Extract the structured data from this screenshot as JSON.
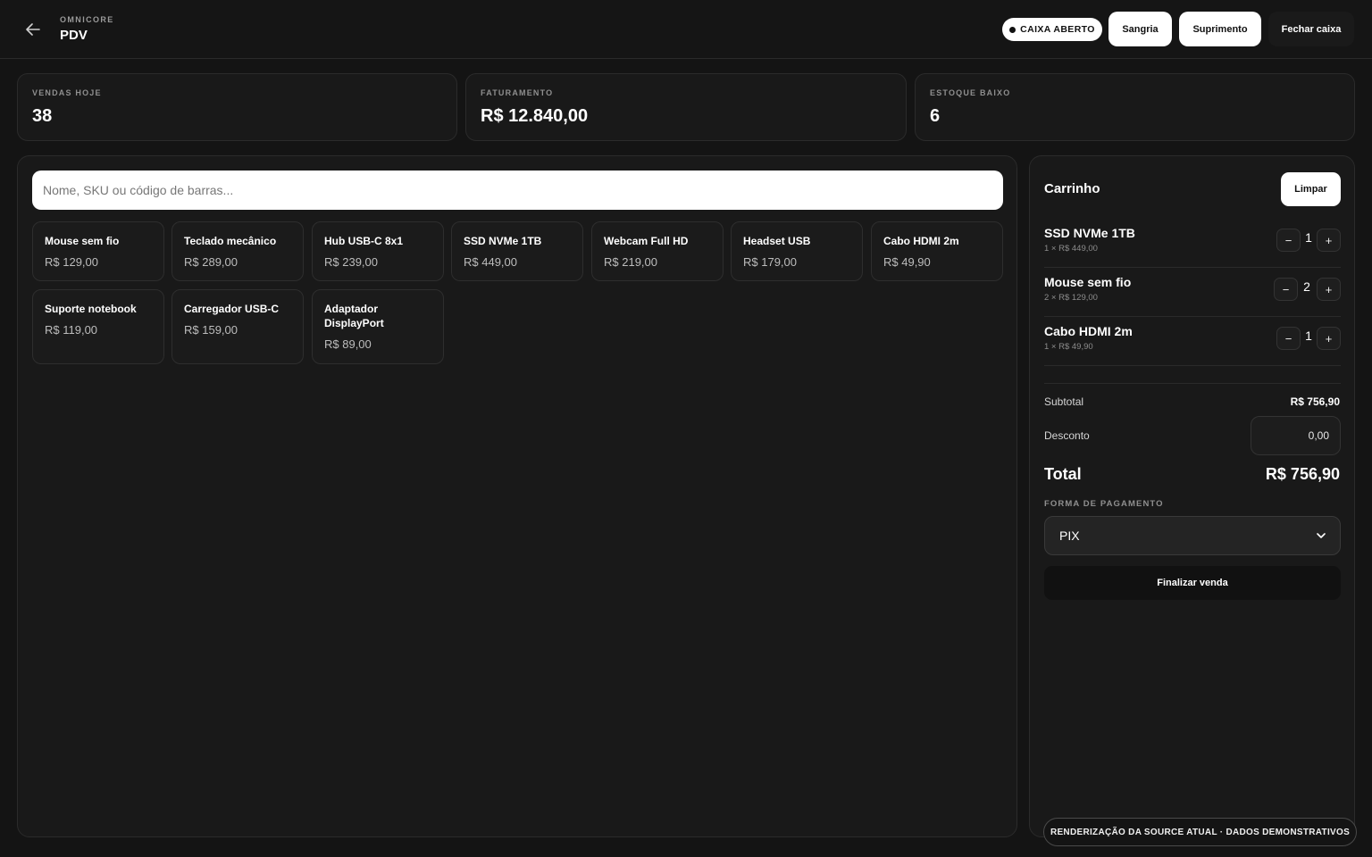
{
  "header": {
    "brand_sub": "OMNICORE",
    "title": "PDV",
    "status": "CAIXA ABERTO",
    "sangria": "Sangria",
    "suprimento": "Suprimento",
    "fechar": "Fechar caixa"
  },
  "stats": [
    {
      "label": "VENDAS HOJE",
      "value": "38"
    },
    {
      "label": "FATURAMENTO",
      "value": "R$ 12.840,00"
    },
    {
      "label": "ESTOQUE BAIXO",
      "value": "6"
    }
  ],
  "search": {
    "placeholder": "Nome, SKU ou código de barras..."
  },
  "products": [
    {
      "name": "Mouse sem fio",
      "price": "R$ 129,00"
    },
    {
      "name": "Teclado mecânico",
      "price": "R$ 289,00"
    },
    {
      "name": "Hub USB-C 8x1",
      "price": "R$ 239,00"
    },
    {
      "name": "SSD NVMe 1TB",
      "price": "R$ 449,00"
    },
    {
      "name": "Webcam Full HD",
      "price": "R$ 219,00"
    },
    {
      "name": "Headset USB",
      "price": "R$ 179,00"
    },
    {
      "name": "Cabo HDMI 2m",
      "price": "R$ 49,90"
    },
    {
      "name": "Suporte notebook",
      "price": "R$ 119,00"
    },
    {
      "name": "Carregador USB-C",
      "price": "R$ 159,00"
    },
    {
      "name": "Adaptador DisplayPort",
      "price": "R$ 89,00"
    }
  ],
  "cart": {
    "title": "Carrinho",
    "clear": "Limpar",
    "items": [
      {
        "name": "SSD NVMe 1TB",
        "detail": "1 × R$ 449,00",
        "qty": "1"
      },
      {
        "name": "Mouse sem fio",
        "detail": "2 × R$ 129,00",
        "qty": "2"
      },
      {
        "name": "Cabo HDMI 2m",
        "detail": "1 × R$ 49,90",
        "qty": "1"
      }
    ],
    "minus": "−",
    "plus": "+",
    "subtotal_label": "Subtotal",
    "subtotal_value": "R$ 756,90",
    "discount_label": "Desconto",
    "discount_value": "0,00",
    "total_label": "Total",
    "total_value": "R$ 756,90",
    "payment_label": "FORMA DE PAGAMENTO",
    "payment_value": "PIX",
    "finish": "Finalizar venda"
  },
  "footer_note": "RENDERIZAÇÃO DA SOURCE ATUAL · DADOS DEMONSTRATIVOS"
}
